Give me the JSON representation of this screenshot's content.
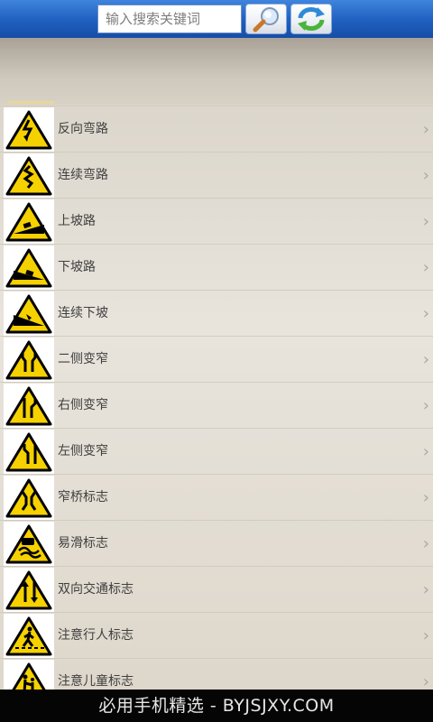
{
  "search": {
    "placeholder": "输入搜索关键词"
  },
  "icons": {
    "search_button": "magnifier-icon",
    "refresh_button": "refresh-icon",
    "row_chevron": "chevron-right-icon"
  },
  "list": {
    "items": [
      {
        "label": "反向弯路",
        "icon": "reverse-curve-sign-icon"
      },
      {
        "label": "连续弯路",
        "icon": "winding-road-sign-icon"
      },
      {
        "label": "上坡路",
        "icon": "uphill-sign-icon"
      },
      {
        "label": "下坡路",
        "icon": "downhill-sign-icon"
      },
      {
        "label": "连续下坡",
        "icon": "continuous-downhill-sign-icon"
      },
      {
        "label": "二侧变窄",
        "icon": "road-narrows-both-sides-sign-icon"
      },
      {
        "label": "右侧变窄",
        "icon": "road-narrows-right-sign-icon"
      },
      {
        "label": "左侧变窄",
        "icon": "road-narrows-left-sign-icon"
      },
      {
        "label": "窄桥标志",
        "icon": "narrow-bridge-sign-icon"
      },
      {
        "label": "易滑标志",
        "icon": "slippery-road-sign-icon"
      },
      {
        "label": "双向交通标志",
        "icon": "two-way-traffic-sign-icon"
      },
      {
        "label": "注意行人标志",
        "icon": "pedestrian-crossing-sign-icon"
      },
      {
        "label": "注意儿童标志",
        "icon": "children-crossing-sign-icon"
      }
    ],
    "chevron": "›"
  },
  "footer": {
    "watermark": "必用手机精选 - BYJSJXY.COM"
  },
  "colors": {
    "top_bar": "#1f5fbf",
    "sign_yellow": "#f5d100",
    "sign_border": "#000000"
  }
}
